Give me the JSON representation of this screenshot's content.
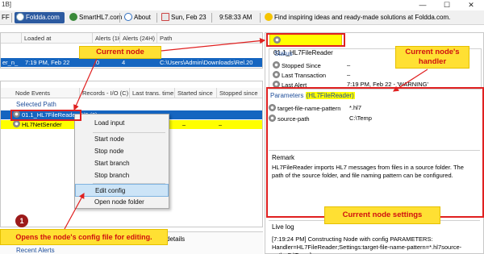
{
  "window": {
    "title": "1B]",
    "minimize": "—",
    "maximize": "☐",
    "close": "✕"
  },
  "toolbar": {
    "ff": "FF",
    "foldda": "Foldda.com",
    "smarthl7": "SmartHL7.com",
    "about": "About",
    "date": "Sun, Feb 23",
    "time": "9:58:33 AM",
    "tip": "Find inspiring ideas and ready-made solutions at Foldda.com."
  },
  "top_table": {
    "headers": [
      "Loaded at",
      "Alerts (1H)",
      "Alerts (24H)",
      "Path"
    ],
    "row": {
      "name": "er_n_",
      "loaded": "7:19 PM, Feb 22",
      "alerts1": "0",
      "alerts24": "4",
      "path": "C:\\Users\\Admin\\Downloads\\Rel.20"
    }
  },
  "node_table": {
    "headers": [
      "Node Events",
      "Records - I/O (C)",
      "Last trans. time",
      "Started since",
      "Stopped since"
    ],
    "section": "Selected Path",
    "rows": [
      {
        "name": "01.1_HL7FileReader",
        "records": "0/0 (0)",
        "last": "–",
        "started": "–",
        "stopped": "–"
      },
      {
        "name": "HL7NetSender",
        "records": "",
        "last": "–",
        "started": "–",
        "stopped": "–"
      }
    ]
  },
  "context_menu": {
    "items": [
      "Load input",
      "Start node",
      "Stop node",
      "Start branch",
      "Stop branch",
      "Edit config",
      "Open node folder"
    ]
  },
  "bottom": {
    "details_tab": "details",
    "recent_alerts": "Recent Alerts"
  },
  "right_panel": {
    "node_title": "01.1_HL7FileReader",
    "status": {
      "heading": "Status",
      "stopped_since": "Stopped Since",
      "stopped_val": "–",
      "last_transaction": "Last Transaction",
      "last_transaction_val": "–",
      "last_alert": "Last Alert",
      "last_alert_val": "7:19 PM, Feb 22 - 'WARNING'"
    },
    "params": {
      "heading": "Parameters",
      "handler": "(HL7FileReader)",
      "p1_name": "target-file-name-pattern",
      "p1_val": "*.hl7",
      "p2_name": "source-path",
      "p2_val": "C:\\Temp"
    },
    "remark": {
      "heading": "Remark",
      "text": "HL7FileReader imports HL7 messages from files in a source folder. The path of the source folder, and file naming pattern can be configured."
    },
    "live_log": {
      "heading": "Live log",
      "text": "[7:19:24 PM] Constructing Node with config PARAMETERS: Handler=HL7FileReader;Settings:target-file-name-pattern=*.hl7source-path=C:\\Temp]"
    }
  },
  "annotations": {
    "current_node": "Current node",
    "current_handler": "Current node's handler",
    "current_settings": "Current node settings",
    "step_number": "1",
    "step_text": "Opens the node's config file for editing."
  },
  "colors": {
    "selected_row": "#ffff00",
    "selected_blue": "#1565c0",
    "callout_bg": "#ffe033",
    "callout_text": "#d01010",
    "annotation_border": "#e02020"
  }
}
